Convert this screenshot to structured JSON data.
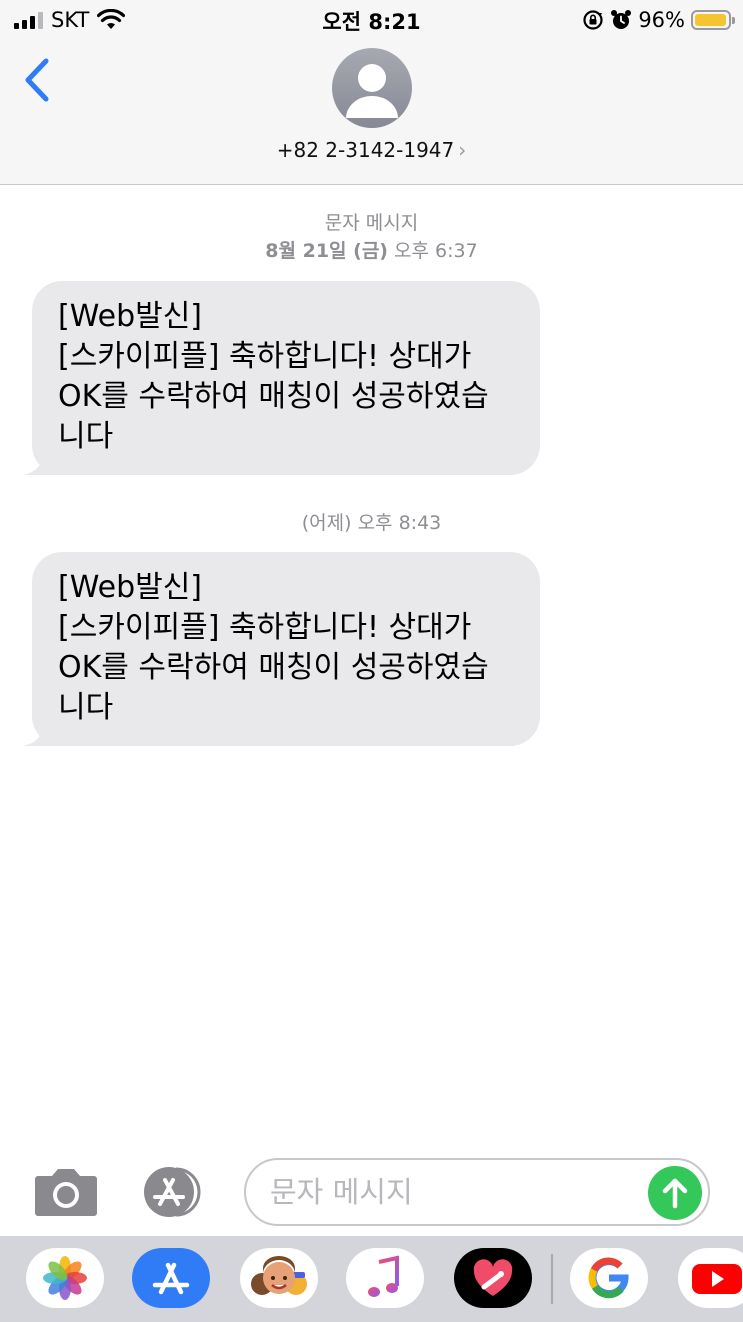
{
  "status_bar": {
    "carrier": "SKT",
    "time": "오전 8:21",
    "battery_percent": "96%",
    "battery_level": 0.96,
    "icons": [
      "signal-icon",
      "wifi-icon",
      "rotation-lock-icon",
      "alarm-icon",
      "battery-icon"
    ]
  },
  "header": {
    "contact_number": "+82 2-3142-1947",
    "chevron": "›"
  },
  "conversation": {
    "sections": [
      {
        "service_label": "문자 메시지",
        "date_bold": "8월 21일 (금)",
        "time": "오후 6:37"
      },
      {
        "date_text": "(어제)",
        "time": "오후 8:43"
      }
    ],
    "messages": [
      {
        "lines": [
          "[Web발신]",
          "[스카이피플] 축하합니다! 상대가",
          "OK를 수락하여 매칭이 성공하였습",
          "니다"
        ]
      },
      {
        "lines": [
          "[Web발신]",
          "[스카이피플] 축하합니다! 상대가",
          "OK를 수락하여 매칭이 성공하였습",
          "니다"
        ]
      }
    ]
  },
  "composer": {
    "placeholder": "문자 메시지",
    "value": ""
  },
  "colors": {
    "accent": "#2f7cf6",
    "bubble": "#e9e9eb",
    "send": "#34c759",
    "battery": "#f5c531"
  },
  "app_drawer": [
    "photos-icon",
    "app-store-icon",
    "memoji-icon",
    "music-icon",
    "digital-touch-icon",
    "google-icon",
    "youtube-icon"
  ]
}
